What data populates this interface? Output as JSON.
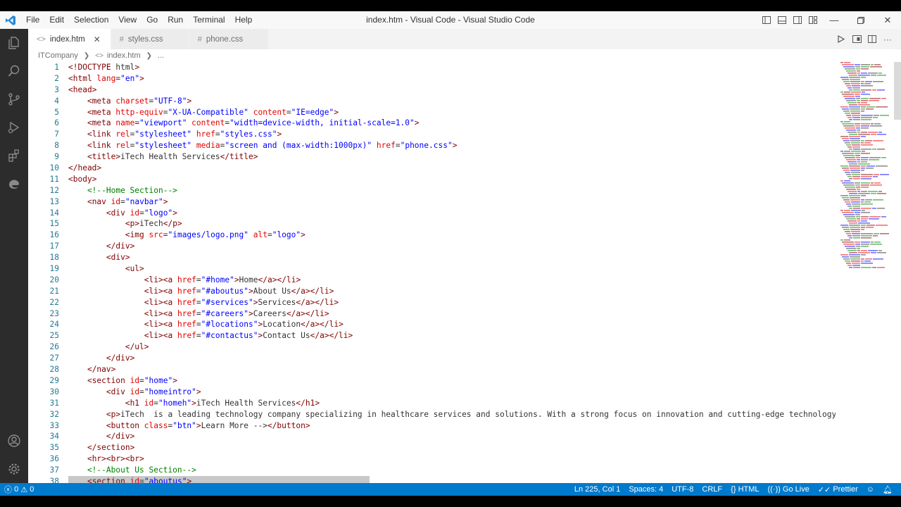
{
  "window": {
    "title": "index.htm - Visual Code - Visual Studio Code"
  },
  "menu": [
    "File",
    "Edit",
    "Selection",
    "View",
    "Go",
    "Run",
    "Terminal",
    "Help"
  ],
  "tabs": [
    {
      "label": "index.htm",
      "icon": "<>",
      "active": true
    },
    {
      "label": "styles.css",
      "icon": "#",
      "active": false
    },
    {
      "label": "phone.css",
      "icon": "#",
      "active": false
    }
  ],
  "breadcrumb": {
    "folder": "ITCompany",
    "file": "index.htm",
    "more": "..."
  },
  "editor": {
    "line_numbers": [
      "1",
      "2",
      "3",
      "4",
      "5",
      "6",
      "7",
      "8",
      "9",
      "10",
      "11",
      "12",
      "13",
      "14",
      "15",
      "16",
      "17",
      "18",
      "19",
      "20",
      "21",
      "22",
      "23",
      "24",
      "25",
      "26",
      "27",
      "28",
      "29",
      "30",
      "31",
      "32",
      "33",
      "34",
      "35",
      "36",
      "37",
      "38"
    ],
    "lines": [
      "<!DOCTYPE html>",
      "<html lang=\"en\">",
      "<head>",
      "    <meta charset=\"UTF-8\">",
      "    <meta http-equiv=\"X-UA-Compatible\" content=\"IE=edge\">",
      "    <meta name=\"viewport\" content=\"width=device-width, initial-scale=1.0\">",
      "    <link rel=\"stylesheet\" href=\"styles.css\">",
      "    <link rel=\"stylesheet\" media=\"screen and (max-width:1000px)\" href=\"phone.css\">",
      "    <title>iTech Health Services</title>",
      "</head>",
      "<body>",
      "    <!--Home Section-->",
      "    <nav id=\"navbar\">",
      "        <div id=\"logo\">",
      "            <p>iTech</p>",
      "            <img src=\"images/logo.png\" alt=\"logo\">",
      "        </div>",
      "        <div>",
      "            <ul>",
      "                <li><a href=\"#home\">Home</a></li>",
      "                <li><a href=\"#aboutus\">About Us</a></li>",
      "                <li><a href=\"#services\">Services</a></li>",
      "                <li><a href=\"#careers\">Careers</a></li>",
      "                <li><a href=\"#locations\">Location</a></li>",
      "                <li><a href=\"#contactus\">Contact Us</a></li>",
      "            </ul>",
      "        </div>",
      "    </nav>",
      "    <section id=\"home\">",
      "        <div id=\"homeintro\">",
      "            <h1 id=\"homeh\">iTech Health Services</h1>",
      "        <p>iTech  is a leading technology company specializing in healthcare services and solutions. With a strong focus on innovation and cutting-edge technology, iTech",
      "        <button class=\"btn\">Learn More --></button>",
      "        </div>",
      "    </section>",
      "    <hr><br><br>",
      "    <!--About Us Section-->",
      "    <section id=\"aboutus\">"
    ]
  },
  "statusbar": {
    "errors": "0",
    "warnings": "0",
    "cursor": "Ln 225, Col 1",
    "spaces": "Spaces: 4",
    "encoding": "UTF-8",
    "eol": "CRLF",
    "language": "HTML",
    "golive": "Go Live",
    "prettier": "Prettier"
  },
  "colors": {
    "accent": "#007acc",
    "activity_bar": "#2c2c2c",
    "tag": "#800000",
    "attr": "#e50000",
    "string": "#0000ff",
    "comment": "#008000"
  },
  "icons": {
    "activity": [
      "files-icon",
      "search-icon",
      "source-control-icon",
      "run-debug-icon",
      "extensions-icon",
      "edge-icon"
    ],
    "activity_bottom": [
      "account-icon",
      "settings-gear-icon"
    ]
  }
}
